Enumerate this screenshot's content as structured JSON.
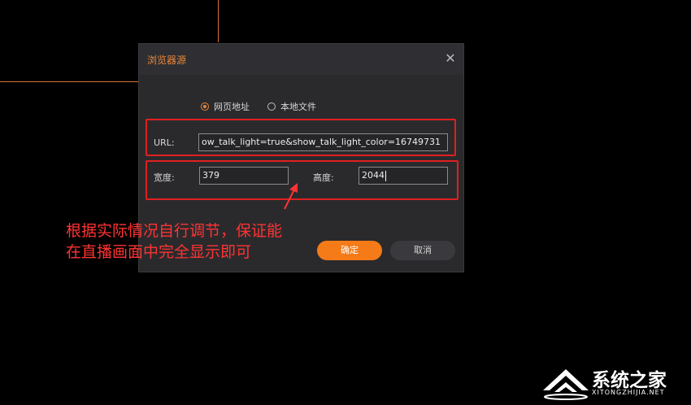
{
  "dialog": {
    "title": "浏览器源",
    "close_icon": "close-icon",
    "source_options": [
      {
        "label": "网页地址",
        "checked": true
      },
      {
        "label": "本地文件",
        "checked": false
      }
    ],
    "url": {
      "label": "URL:",
      "value": "ow_talk_light=true&show_talk_light_color=16749731"
    },
    "width": {
      "label": "宽度:",
      "value": "379"
    },
    "height": {
      "label": "高度:",
      "value": "2044"
    },
    "confirm_label": "确定",
    "cancel_label": "取消"
  },
  "annotation": {
    "line1": "根据实际情况自行调节，保证能",
    "line2": "在直播画面中完全显示即可"
  },
  "watermark": {
    "text": "系统之家",
    "subtext": "XITONGZHIJIA.NET"
  },
  "colors": {
    "accent": "#f57b18",
    "title": "#e8863a",
    "annotation": "#ff3333",
    "highlight_border": "#e02020",
    "dialog_bg": "#2a2a2d",
    "page_bg": "#000000"
  }
}
